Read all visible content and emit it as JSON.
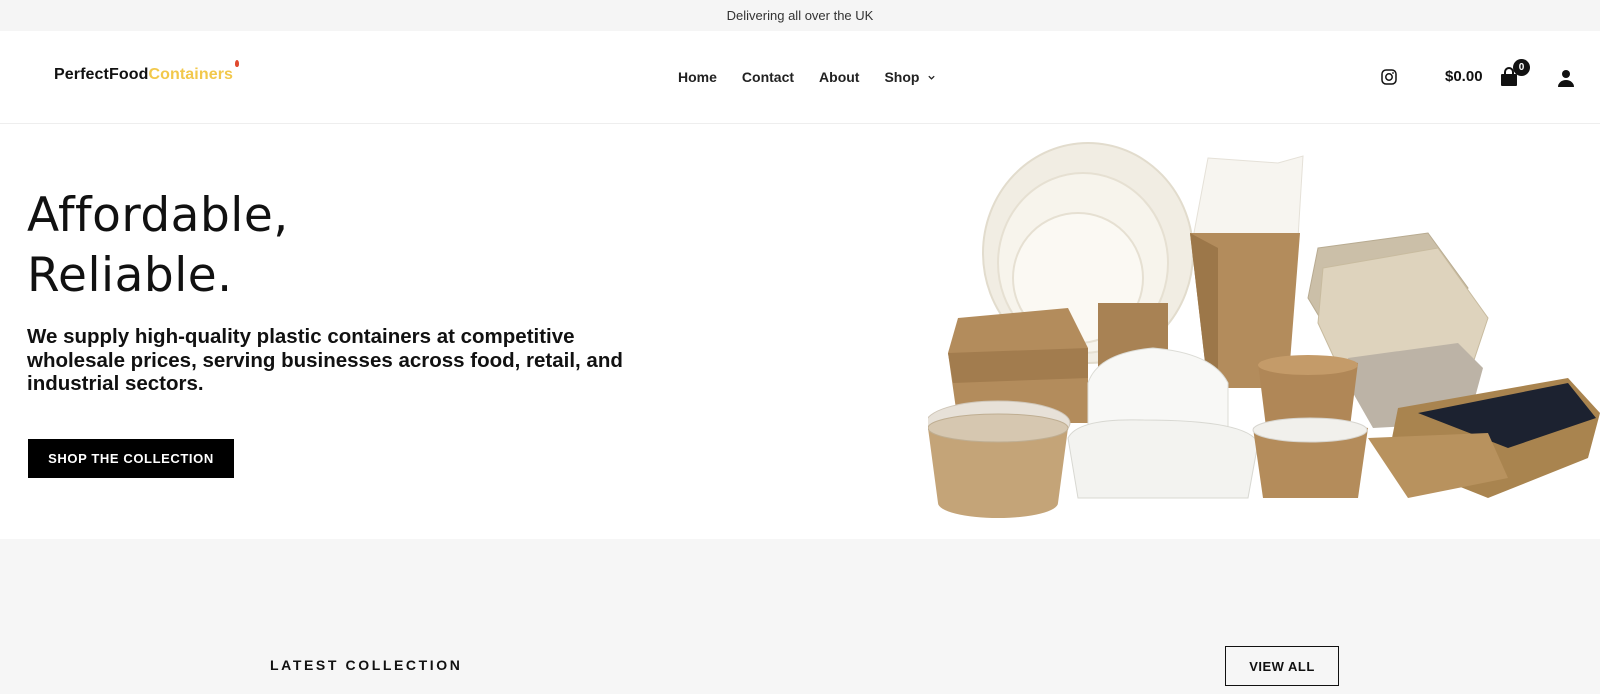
{
  "topbar": {
    "text": "Delivering all over the UK"
  },
  "header": {
    "logo": {
      "part1": "PerfectFood",
      "part2": "Containers"
    },
    "nav": [
      {
        "label": "Home"
      },
      {
        "label": "Contact"
      },
      {
        "label": "About"
      },
      {
        "label": "Shop",
        "has_dropdown": true
      }
    ],
    "cart": {
      "total": "$0.00",
      "count": "0"
    },
    "icons": [
      "instagram-icon",
      "shopping-bag-icon",
      "user-icon",
      "chevron-down-icon"
    ]
  },
  "hero": {
    "title_line1": "Affordable,",
    "title_line2": "Reliable.",
    "subtitle": "We supply high-quality plastic containers at competitive wholesale prices, serving businesses across food, retail, and industrial sectors.",
    "cta": "SHOP THE COLLECTION"
  },
  "latest": {
    "title": "LATEST COLLECTION",
    "view_all": "VIEW ALL"
  },
  "colors": {
    "accent_yellow": "#f2c84b",
    "topbar_bg": "#f5f5f5",
    "section_bg": "#f6f6f6",
    "button_black": "#000000",
    "kraft": "#b89466"
  }
}
